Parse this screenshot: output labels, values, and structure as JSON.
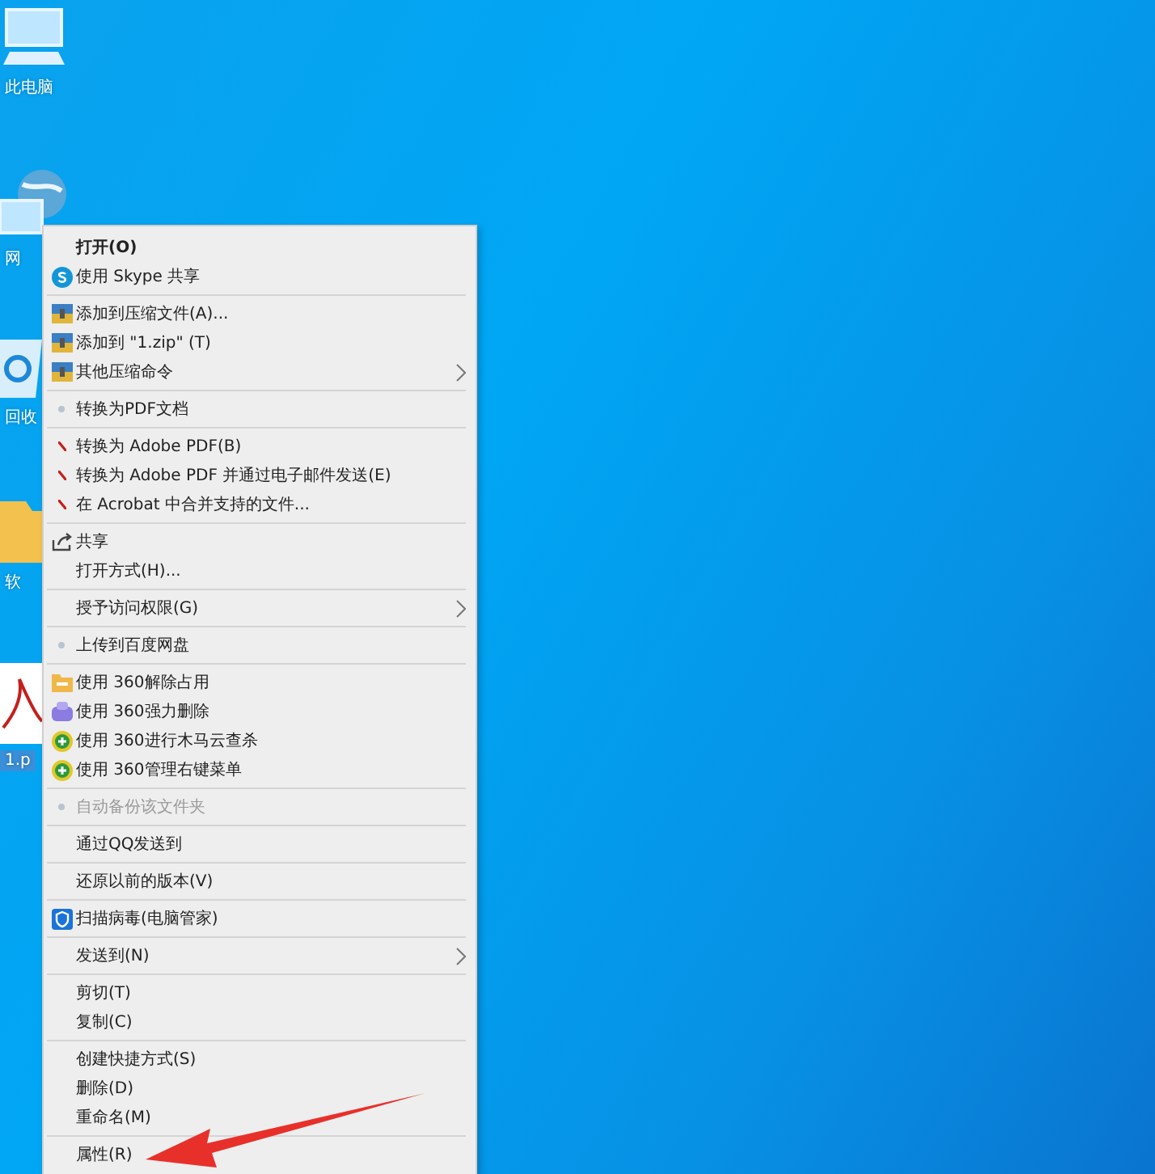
{
  "desktop_icons": [
    {
      "label": "此电脑",
      "kind": "computer"
    },
    {
      "label": "网",
      "kind": "network"
    },
    {
      "label": "回收",
      "kind": "recycle"
    },
    {
      "label": "软",
      "kind": "folder"
    },
    {
      "label": "1.p",
      "kind": "pdf"
    }
  ],
  "context_menu": {
    "groups": [
      {
        "items": [
          {
            "label": "打开(O)",
            "default": true,
            "submenu": false,
            "disabled": false
          },
          {
            "label": "使用 Skype 共享",
            "kind": "skype",
            "default": false,
            "submenu": false,
            "disabled": false
          }
        ]
      },
      {
        "items": [
          {
            "label": "添加到压缩文件(A)...",
            "kind": "archive",
            "default": false,
            "submenu": false,
            "disabled": false
          },
          {
            "label": "添加到 \"1.zip\" (T)",
            "kind": "archive",
            "default": false,
            "submenu": false,
            "disabled": false
          },
          {
            "label": "其他压缩命令",
            "kind": "archive",
            "default": false,
            "submenu": true,
            "disabled": false
          }
        ]
      },
      {
        "items": [
          {
            "label": "转换为PDF文档",
            "kind": "dot",
            "default": false,
            "submenu": false,
            "disabled": false
          }
        ]
      },
      {
        "items": [
          {
            "label": "转换为 Adobe PDF(B)",
            "kind": "acrobat",
            "default": false,
            "submenu": false,
            "disabled": false
          },
          {
            "label": "转换为 Adobe PDF 并通过电子邮件发送(E)",
            "kind": "acrobat",
            "default": false,
            "submenu": false,
            "disabled": false
          },
          {
            "label": "在 Acrobat 中合并支持的文件...",
            "kind": "acrobat",
            "default": false,
            "submenu": false,
            "disabled": false
          }
        ]
      },
      {
        "items": [
          {
            "label": "共享",
            "kind": "share",
            "default": false,
            "submenu": false,
            "disabled": false
          },
          {
            "label": "打开方式(H)...",
            "default": false,
            "submenu": false,
            "disabled": false
          }
        ]
      },
      {
        "items": [
          {
            "label": "授予访问权限(G)",
            "default": false,
            "submenu": true,
            "disabled": false
          }
        ]
      },
      {
        "items": [
          {
            "label": "上传到百度网盘",
            "kind": "dot",
            "default": false,
            "submenu": false,
            "disabled": false
          }
        ]
      },
      {
        "items": [
          {
            "label": "使用 360解除占用",
            "kind": "folder360",
            "default": false,
            "submenu": false,
            "disabled": false
          },
          {
            "label": "使用 360强力删除",
            "kind": "purple360",
            "default": false,
            "submenu": false,
            "disabled": false
          },
          {
            "label": "使用 360进行木马云查杀",
            "kind": "green360",
            "default": false,
            "submenu": false,
            "disabled": false
          },
          {
            "label": "使用 360管理右键菜单",
            "kind": "green360",
            "default": false,
            "submenu": false,
            "disabled": false
          }
        ]
      },
      {
        "items": [
          {
            "label": "自动备份该文件夹",
            "kind": "dot",
            "default": false,
            "submenu": false,
            "disabled": true
          }
        ]
      },
      {
        "items": [
          {
            "label": "通过QQ发送到",
            "default": false,
            "submenu": false,
            "disabled": false
          }
        ]
      },
      {
        "items": [
          {
            "label": "还原以前的版本(V)",
            "default": false,
            "submenu": false,
            "disabled": false
          }
        ]
      },
      {
        "items": [
          {
            "label": "扫描病毒(电脑管家)",
            "kind": "shield",
            "default": false,
            "submenu": false,
            "disabled": false
          }
        ]
      },
      {
        "items": [
          {
            "label": "发送到(N)",
            "default": false,
            "submenu": true,
            "disabled": false
          }
        ]
      },
      {
        "items": [
          {
            "label": "剪切(T)",
            "default": false,
            "submenu": false,
            "disabled": false
          },
          {
            "label": "复制(C)",
            "default": false,
            "submenu": false,
            "disabled": false
          }
        ]
      },
      {
        "items": [
          {
            "label": "创建快捷方式(S)",
            "default": false,
            "submenu": false,
            "disabled": false
          },
          {
            "label": "删除(D)",
            "default": false,
            "submenu": false,
            "disabled": false
          },
          {
            "label": "重命名(M)",
            "default": false,
            "submenu": false,
            "disabled": false
          }
        ]
      },
      {
        "items": [
          {
            "label": "属性(R)",
            "default": false,
            "submenu": false,
            "disabled": false
          }
        ]
      }
    ]
  }
}
